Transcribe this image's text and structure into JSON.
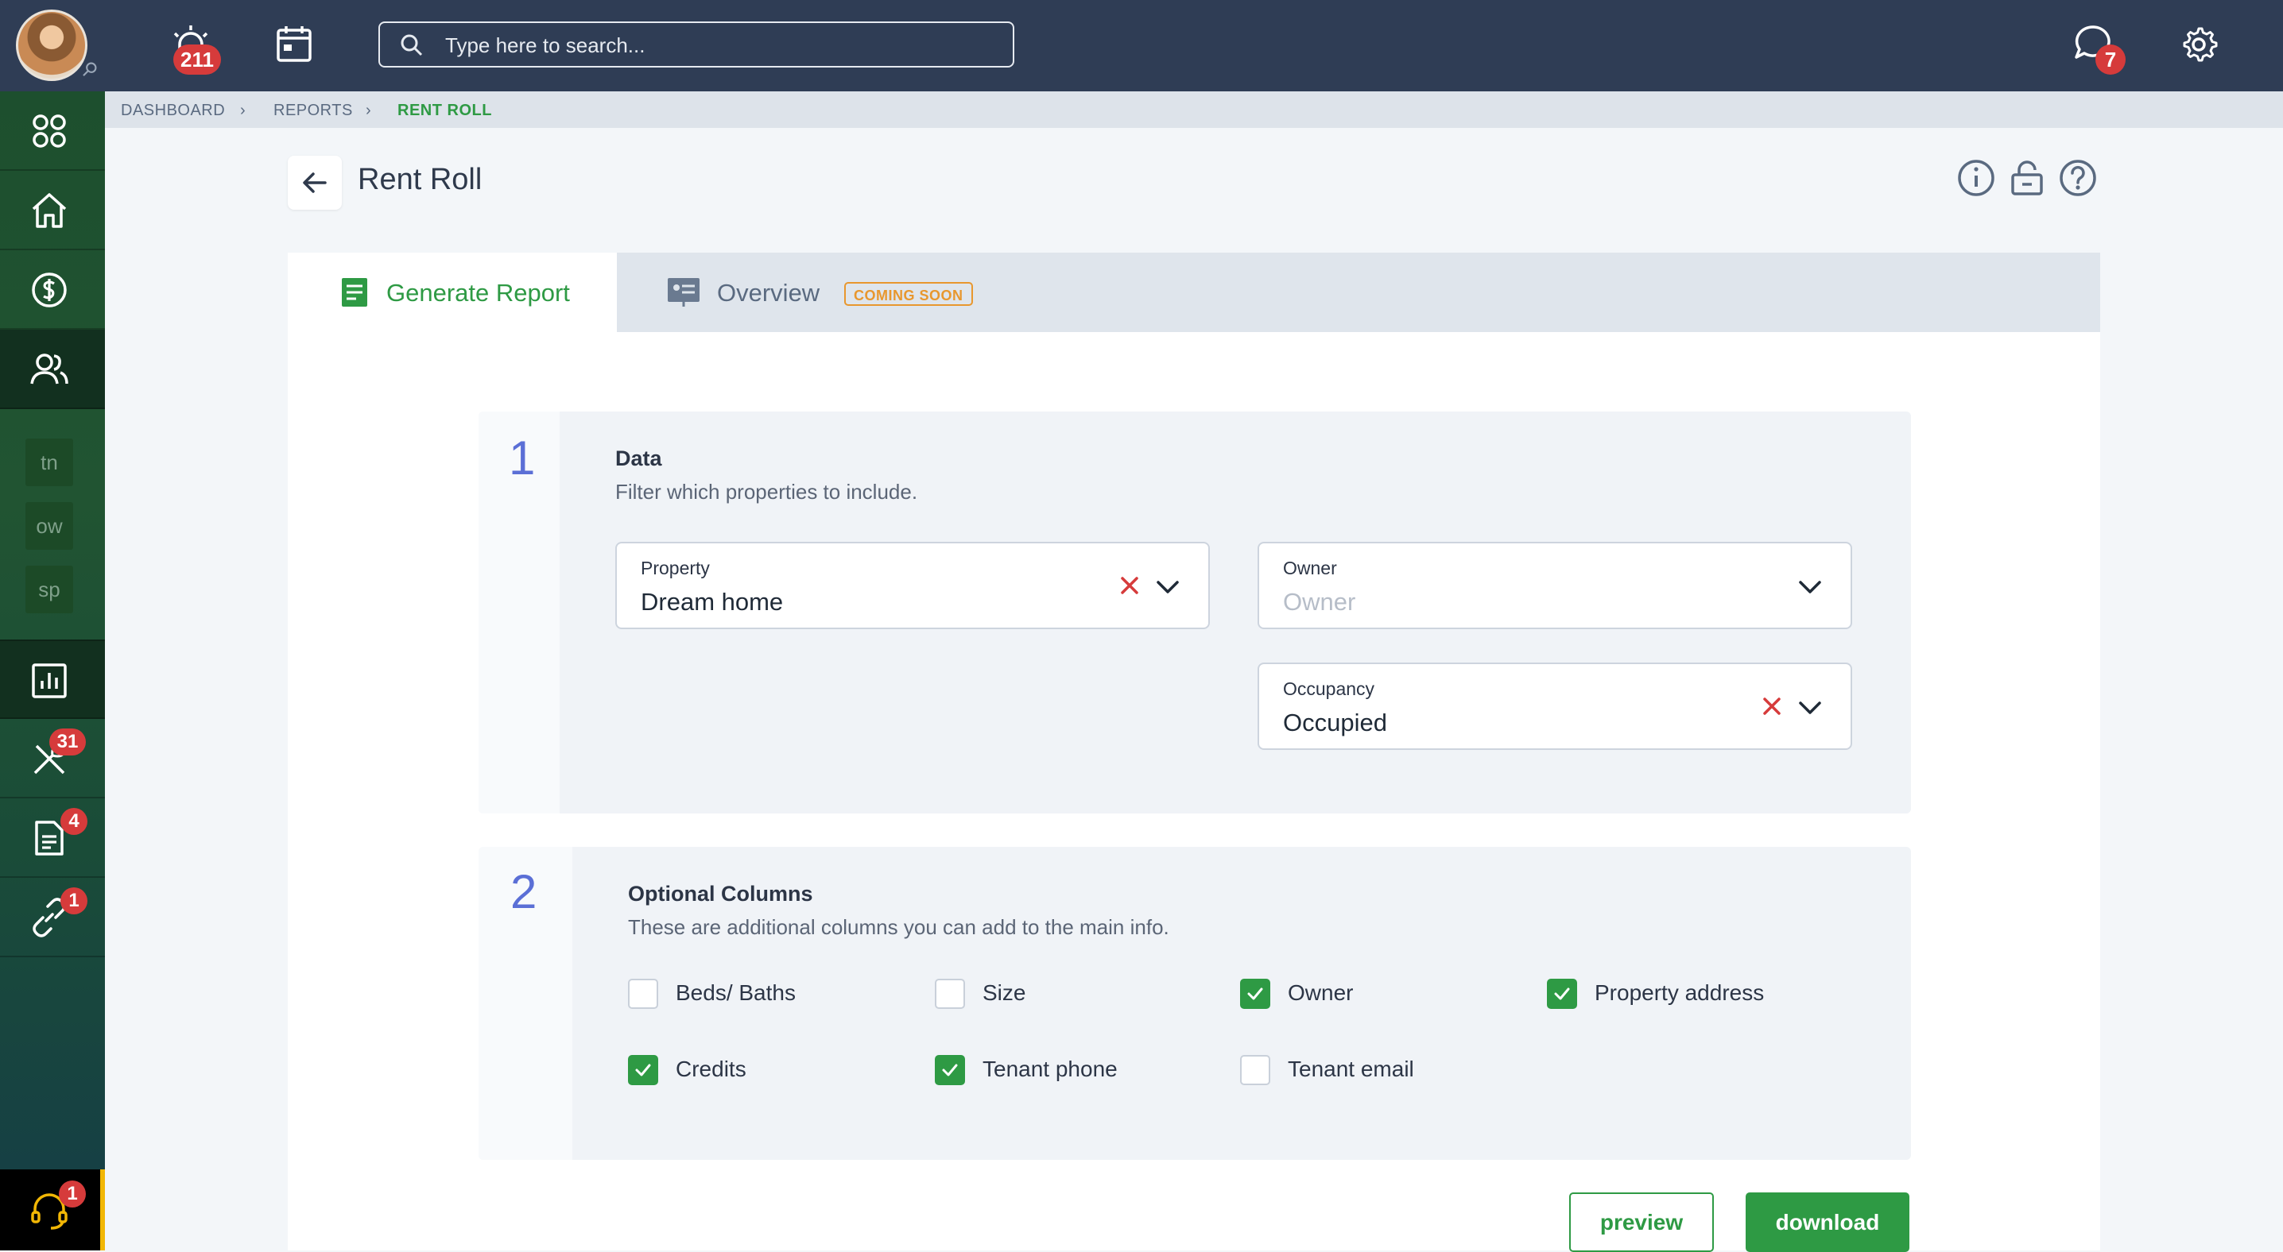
{
  "topbar": {
    "alerts_badge": "211",
    "messages_badge": "7",
    "search": {
      "placeholder": "Type here to search...",
      "value": ""
    }
  },
  "sidebar": {
    "items": [
      {
        "icon": "apps-grid-icon"
      },
      {
        "icon": "home-icon"
      },
      {
        "icon": "dollar-circle-icon"
      },
      {
        "icon": "people-icon",
        "active": true
      },
      {
        "icon": "report-chart-icon"
      },
      {
        "icon": "tools-icon",
        "badge": "31"
      },
      {
        "icon": "document-icon",
        "badge": "4"
      },
      {
        "icon": "link-icon",
        "badge": "1"
      }
    ],
    "shortcuts": [
      "tn",
      "ow",
      "sp"
    ],
    "support_badge": "1"
  },
  "breadcrumb": [
    "DASHBOARD",
    "REPORTS",
    "RENT ROLL"
  ],
  "page": {
    "title": "Rent Roll"
  },
  "tabs": [
    {
      "label": "Generate Report",
      "active": true
    },
    {
      "label": "Overview",
      "tag": "COMING SOON"
    }
  ],
  "section1": {
    "number": "1",
    "title": "Data",
    "subtitle": "Filter which properties to include.",
    "property": {
      "label": "Property",
      "value": "Dream home"
    },
    "owner": {
      "label": "Owner",
      "placeholder": "Owner"
    },
    "occupancy": {
      "label": "Occupancy",
      "value": "Occupied"
    }
  },
  "section2": {
    "number": "2",
    "title": "Optional Columns",
    "subtitle": "These are additional columns you can add to the main info.",
    "columns": [
      {
        "label": "Beds/ Baths",
        "checked": false
      },
      {
        "label": "Size",
        "checked": false
      },
      {
        "label": "Owner",
        "checked": true
      },
      {
        "label": "Property address",
        "checked": true
      },
      {
        "label": "Credits",
        "checked": true
      },
      {
        "label": "Tenant phone",
        "checked": true
      },
      {
        "label": "Tenant email",
        "checked": false
      }
    ]
  },
  "actions": {
    "preview": "preview",
    "download": "download"
  },
  "colors": {
    "accent": "#2e9a44",
    "topbar": "#2f3d55",
    "badge": "#d63b3b",
    "step": "#5b6fd6",
    "coming_soon": "#e8972e"
  }
}
